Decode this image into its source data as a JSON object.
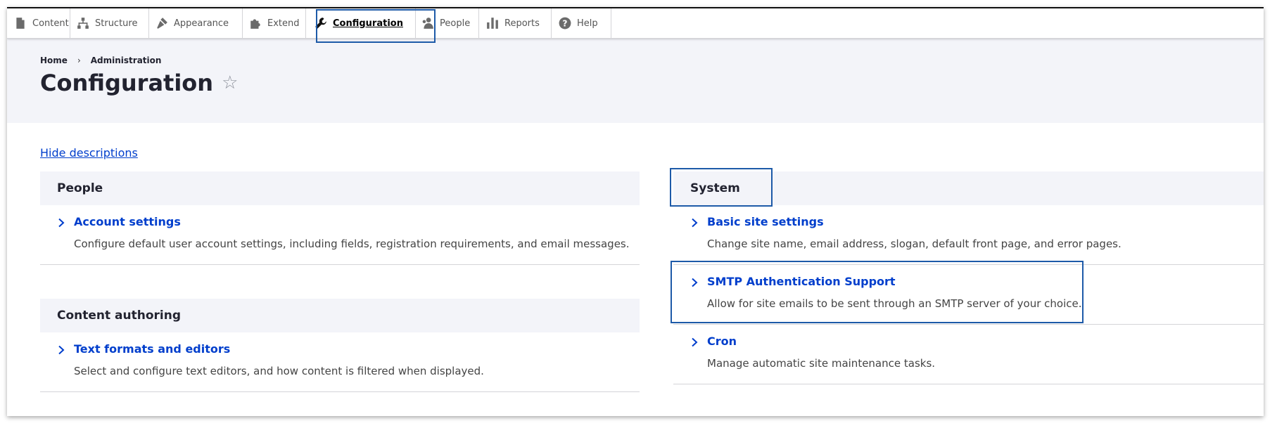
{
  "toolbar": {
    "tabs": [
      {
        "label": "Content",
        "icon": "content-icon"
      },
      {
        "label": "Structure",
        "icon": "structure-icon"
      },
      {
        "label": "Appearance",
        "icon": "appearance-icon"
      },
      {
        "label": "Extend",
        "icon": "extend-icon"
      },
      {
        "label": "Configuration",
        "icon": "wrench-icon",
        "active": true
      },
      {
        "label": "People",
        "icon": "people-icon"
      },
      {
        "label": "Reports",
        "icon": "reports-icon"
      },
      {
        "label": "Help",
        "icon": "help-icon"
      }
    ]
  },
  "breadcrumb": {
    "items": [
      "Home",
      "Administration"
    ],
    "separator": "›"
  },
  "page": {
    "title": "Configuration",
    "favorite_icon": "star-icon",
    "favorite_glyph": "☆"
  },
  "controls": {
    "hide_descriptions": "Hide descriptions"
  },
  "panels": {
    "people": {
      "title": "People",
      "items": [
        {
          "label": "Account settings",
          "description": "Configure default user account settings, including fields, registration requirements, and email messages."
        }
      ]
    },
    "content_authoring": {
      "title": "Content authoring",
      "items": [
        {
          "label": "Text formats and editors",
          "description": "Select and configure text editors, and how content is filtered when displayed."
        }
      ]
    },
    "system": {
      "title": "System",
      "items": [
        {
          "label": "Basic site settings",
          "description": "Change site name, email address, slogan, default front page, and error pages."
        },
        {
          "label": "SMTP Authentication Support",
          "description": "Allow for site emails to be sent through an SMTP server of your choice."
        },
        {
          "label": "Cron",
          "description": "Manage automatic site maintenance tasks."
        }
      ]
    }
  },
  "colors": {
    "link": "#003ecc",
    "header_bg": "#f3f4f9",
    "highlight_border": "#1d5aa8",
    "text": "#222330"
  }
}
